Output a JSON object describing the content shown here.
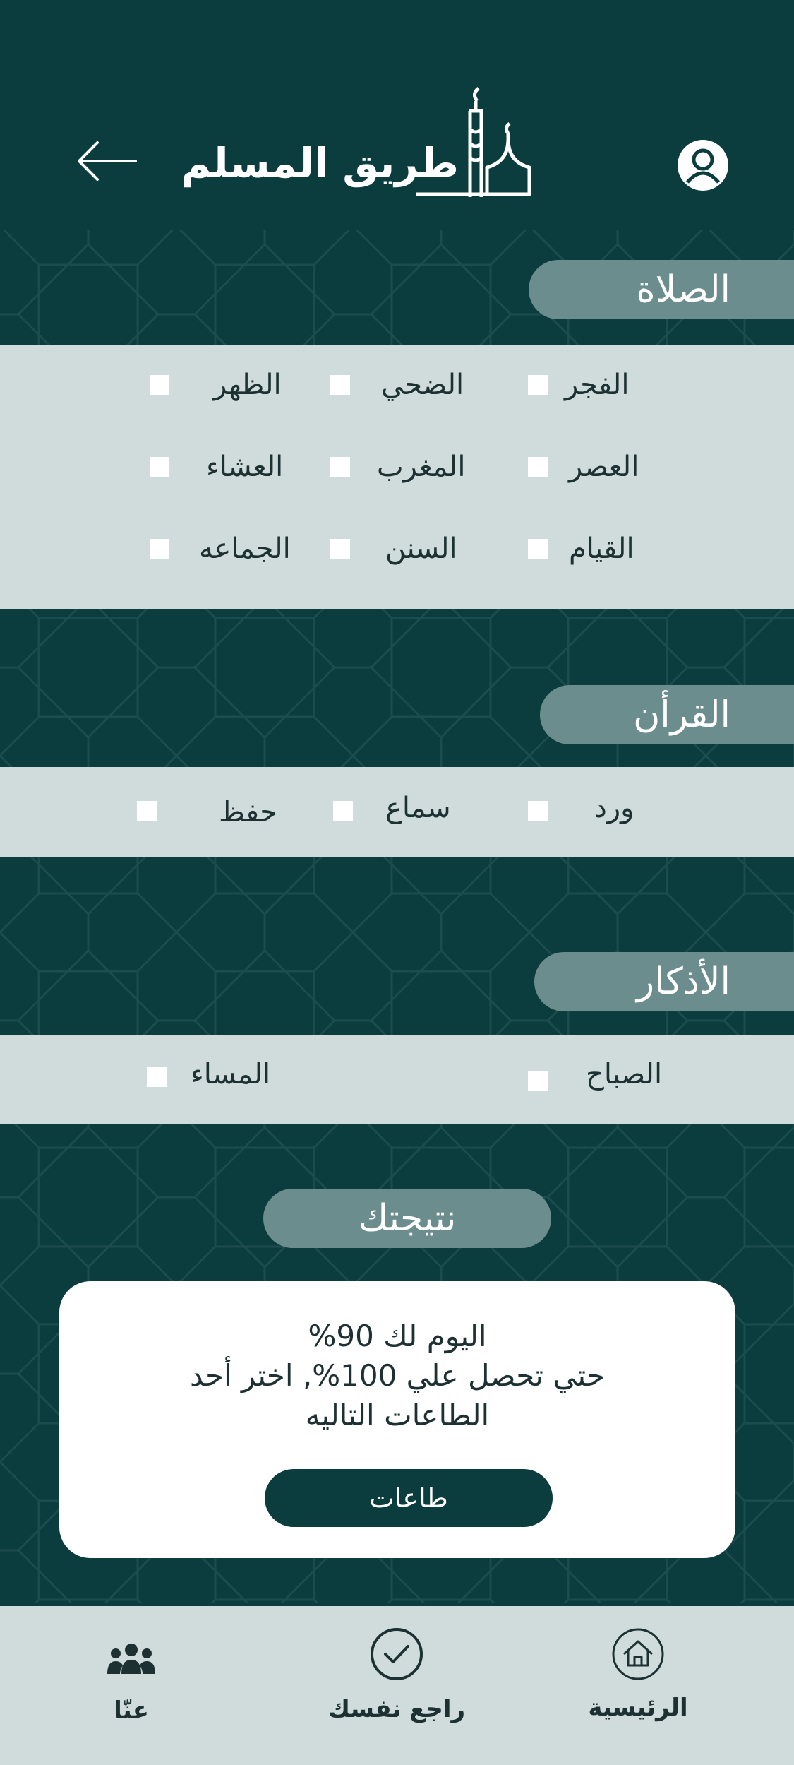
{
  "header": {
    "app_title": "طريق المسلم",
    "back_icon": "arrow-left-icon",
    "profile_icon": "user-avatar-icon"
  },
  "colors": {
    "primary": "#0b3d3e",
    "panel": "#d0dcdc",
    "pill": "#6c8d8e",
    "card": "#ffffff"
  },
  "sections": {
    "prayer": {
      "title": "الصلاة",
      "items": [
        "الفجر",
        "الضحي",
        "الظهر",
        "العصر",
        "المغرب",
        "العشاء",
        "القيام",
        "السنن",
        "الجماعه"
      ]
    },
    "quran": {
      "title": "القرأن",
      "items": [
        "ورد",
        "سماع",
        "حفظ"
      ]
    },
    "adhkar": {
      "title": "الأذكار",
      "items": [
        "الصباح",
        "المساء"
      ]
    }
  },
  "result": {
    "title": "نتيجتك",
    "line1": "%اليوم لك 90",
    "line2": "حتي تحصل علي 100%, اختر أحد",
    "line3": "الطاعات التاليه",
    "button_label": "طاعات"
  },
  "bottom_nav": {
    "home": "الرئيسية",
    "review": "راجع نفسك",
    "about": "عنّا"
  }
}
